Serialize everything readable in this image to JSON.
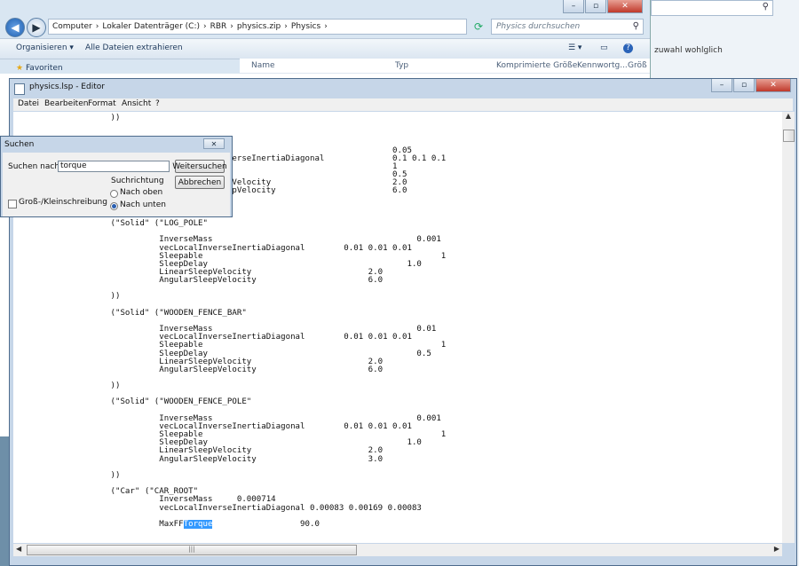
{
  "explorer": {
    "address": [
      "Computer",
      "Lokaler Datenträger (C:)",
      "RBR",
      "physics.zip",
      "Physics"
    ],
    "search_placeholder": "Physics durchsuchen",
    "organize": "Organisieren ▾",
    "extract_all": "Alle Dateien extrahieren",
    "favorites": "Favoriten",
    "columns": [
      "Name",
      "Typ",
      "Komprimierte Größe",
      "Kennwortg...",
      "Größ"
    ]
  },
  "right_window": {
    "fragment": "zuwahl wohlglich"
  },
  "editor": {
    "title": "physics.lsp - Editor",
    "menu": [
      "Datei",
      "Bearbeiten",
      "Format",
      "Ansicht",
      "?"
    ],
    "lines": [
      "                    ))",
      "",
      "",
      "",
      "                                  InverseMass                                 0.05",
      "                                  vecLocalInverseInertiaDiagonal              0.1 0.1 0.1",
      "                                  Sleepable                                   1",
      "                                  SleepDelay                                  0.5",
      "                                  LinearSleepVelocity                         2.0",
      "                                  AngularSleepVelocity                        6.0",
      "",
      "",
      "",
      "                    (\"Solid\" (\"LOG_POLE\"",
      "",
      "                              InverseMass                                          0.001",
      "                              vecLocalInverseInertiaDiagonal        0.01 0.01 0.01",
      "                              Sleepable                                                 1",
      "                              SleepDelay                                         1.0",
      "                              LinearSleepVelocity                        2.0",
      "                              AngularSleepVelocity                       6.0",
      "",
      "                    ))",
      "",
      "                    (\"Solid\" (\"WOODEN_FENCE_BAR\"",
      "",
      "                              InverseMass                                          0.01",
      "                              vecLocalInverseInertiaDiagonal        0.01 0.01 0.01",
      "                              Sleepable                                                 1",
      "                              SleepDelay                                           0.5",
      "                              LinearSleepVelocity                        2.0",
      "                              AngularSleepVelocity                       6.0",
      "",
      "                    ))",
      "",
      "                    (\"Solid\" (\"WOODEN_FENCE_POLE\"",
      "",
      "                              InverseMass                                          0.001",
      "                              vecLocalInverseInertiaDiagonal        0.01 0.01 0.01",
      "                              Sleepable                                                 1",
      "                              SleepDelay                                         1.0",
      "                              LinearSleepVelocity                        2.0",
      "                              AngularSleepVelocity                       3.0",
      "",
      "                    ))",
      "",
      "                    (\"Car\" (\"CAR_ROOT\"",
      "                              InverseMass     0.000714",
      "                              vecLocalInverseInertiaDiagonal 0.00083 0.00169 0.00083",
      ""
    ],
    "last_line_prefix": "                              MaxFF",
    "last_line_highlight": "Torque",
    "last_line_suffix": "                  90.0"
  },
  "find_dialog": {
    "title": "Suchen",
    "search_label": "Suchen nach:",
    "search_value": "torque",
    "find_next": "Weitersuchen",
    "cancel": "Abbrechen",
    "direction_label": "Suchrichtung",
    "up": "Nach oben",
    "down": "Nach unten",
    "match_case": "Groß-/Kleinschreibung"
  }
}
